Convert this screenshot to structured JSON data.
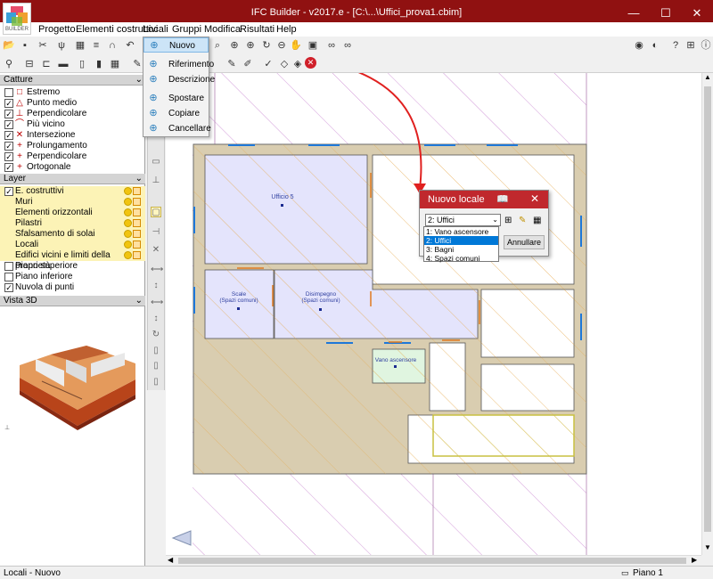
{
  "window": {
    "title": "IFC Builder - v2017.e - [C:\\...\\Uffici_prova1.cbim]",
    "logo_text": "BUILDER",
    "minimize": "—",
    "maximize": "☐",
    "close": "✕"
  },
  "menu": [
    "Progetto",
    "Elementi costruttivi",
    "Locali",
    "Gruppi",
    "Modifica",
    "Risultati",
    "Help"
  ],
  "locali_menu": {
    "items": [
      {
        "label": "Nuovo",
        "icon": "new-room-icon"
      },
      {
        "label": "Riferimento",
        "icon": "reference-icon"
      },
      {
        "label": "Descrizione",
        "icon": "description-icon"
      },
      {
        "label": "Spostare",
        "icon": "move-icon"
      },
      {
        "label": "Copiare",
        "icon": "copy-icon"
      },
      {
        "label": "Cancellare",
        "icon": "delete-icon"
      }
    ]
  },
  "catture": {
    "header": "Catture",
    "items": [
      {
        "label": "Estremo",
        "checked": false,
        "symbol": "□"
      },
      {
        "label": "Punto medio",
        "checked": true,
        "symbol": "△"
      },
      {
        "label": "Perpendicolare",
        "checked": true,
        "symbol": "⊥"
      },
      {
        "label": "Più vicino",
        "checked": true,
        "symbol": "⌒"
      },
      {
        "label": "Intersezione",
        "checked": true,
        "symbol": "✕"
      },
      {
        "label": "Prolungamento",
        "checked": true,
        "symbol": "+"
      },
      {
        "label": "Perpendicolare",
        "checked": true,
        "symbol": "+"
      },
      {
        "label": "Ortogonale",
        "checked": true,
        "symbol": "+"
      }
    ]
  },
  "layer": {
    "header": "Layer",
    "items": [
      {
        "label": "E. costruttivi",
        "checked": true,
        "indent": false,
        "dots": true
      },
      {
        "label": "Muri",
        "checked": null,
        "indent": true,
        "dots": true
      },
      {
        "label": "Elementi orizzontali",
        "checked": null,
        "indent": true,
        "dots": true
      },
      {
        "label": "Pilastri",
        "checked": null,
        "indent": true,
        "dots": true
      },
      {
        "label": "Sfalsamento di solai",
        "checked": null,
        "indent": true,
        "dots": true
      },
      {
        "label": "Locali",
        "checked": null,
        "indent": true,
        "dots": true
      },
      {
        "label": "Edifici vicini e limiti della proprietà",
        "checked": null,
        "indent": true,
        "dots": true
      },
      {
        "label": "Piano superiore",
        "checked": false,
        "indent": false,
        "dots": false
      },
      {
        "label": "Piano inferiore",
        "checked": false,
        "indent": false,
        "dots": false
      },
      {
        "label": "Nuvola di punti",
        "checked": true,
        "indent": false,
        "dots": false
      }
    ]
  },
  "vista3d": {
    "header": "Vista 3D"
  },
  "plan": {
    "rooms": [
      {
        "name": "Ufficio 5",
        "sub": ""
      },
      {
        "name": "Scale",
        "sub": "(Spazi comuni)"
      },
      {
        "name": "Disimpegno",
        "sub": "(Spazi comuni)"
      },
      {
        "name": "Vano ascensore",
        "sub": ""
      }
    ]
  },
  "dialog": {
    "title": "Nuovo locale",
    "selected": "2: Uffici",
    "options": [
      "1: Vano ascensore",
      "2: Uffici",
      "3: Bagni",
      "4: Spazi comuni"
    ],
    "cancel": "Annullare"
  },
  "status": {
    "left": "Locali - Nuovo",
    "right": "Piano 1"
  },
  "colors": {
    "title_bar": "#901111",
    "dialog_title": "#c0282d",
    "room_fill": "#e4e4fc",
    "elevator_fill": "#e0f5e0",
    "wall": "#d9cdb0",
    "arrow": "#e0201f"
  }
}
